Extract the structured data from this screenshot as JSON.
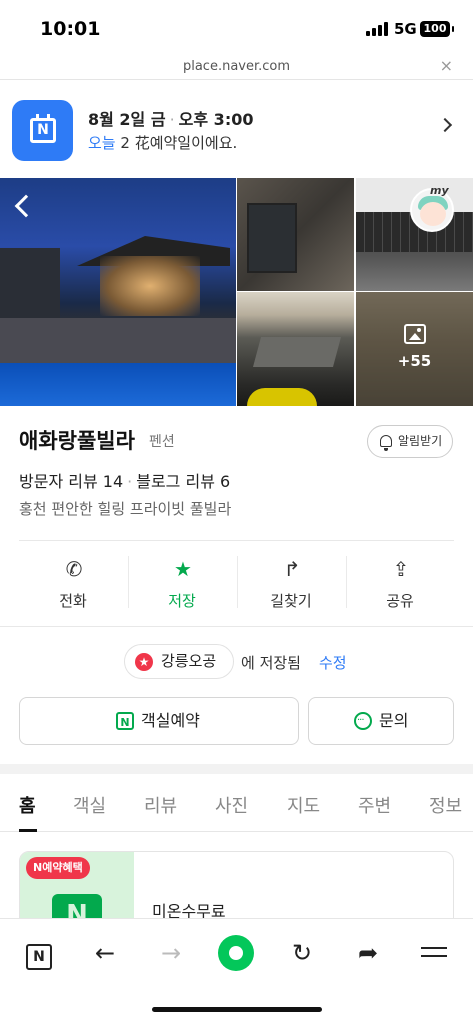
{
  "status_bar": {
    "time": "10:01",
    "network": "5G",
    "battery": "100"
  },
  "url_bar": {
    "url": "place.naver.com",
    "close_icon": "×"
  },
  "reservation_banner": {
    "icon": "naver-calendar-icon",
    "icon_letter": "N",
    "date": "8월 2일 금",
    "separator": "·",
    "time": "오후 3:00",
    "sub_highlight": "오늘",
    "sub_rest": " 2 花예약일이에요."
  },
  "photos": {
    "more_count": "+55",
    "profile_label": "my"
  },
  "place": {
    "name": "애화랑풀빌라",
    "category": "펜션",
    "alarm_label": "알림받기",
    "visitor_reviews": "방문자 리뷰 14",
    "separator": "·",
    "blog_reviews": "블로그 리뷰 6",
    "description": "홍천 편안한 힐링 프라이빗 풀빌라"
  },
  "actions": [
    {
      "label": "전화",
      "icon": "phone-icon"
    },
    {
      "label": "저장",
      "icon": "star-icon"
    },
    {
      "label": "길찾기",
      "icon": "directions-icon"
    },
    {
      "label": "공유",
      "icon": "share-icon"
    }
  ],
  "saved": {
    "folder_name": "강릉오공",
    "saved_text": "에 저장됨",
    "edit_label": "수정"
  },
  "buttons": {
    "reserve_label": "객실예약",
    "inquiry_label": "문의"
  },
  "tabs": [
    "홈",
    "객실",
    "리뷰",
    "사진",
    "지도",
    "주변",
    "정보"
  ],
  "promo": {
    "tag": "N예약혜택",
    "icon_letter": "N",
    "text": "미온수무료"
  },
  "toolbar": {
    "n_label": "N",
    "back_icon": "←",
    "forward_icon": "→",
    "reload_icon": "↻",
    "share_icon": "➦"
  },
  "colors": {
    "naver_green": "#03C75A",
    "accent_blue": "#2E7BF6",
    "save_green": "#03A94D",
    "tag_red": "#F0364A"
  }
}
